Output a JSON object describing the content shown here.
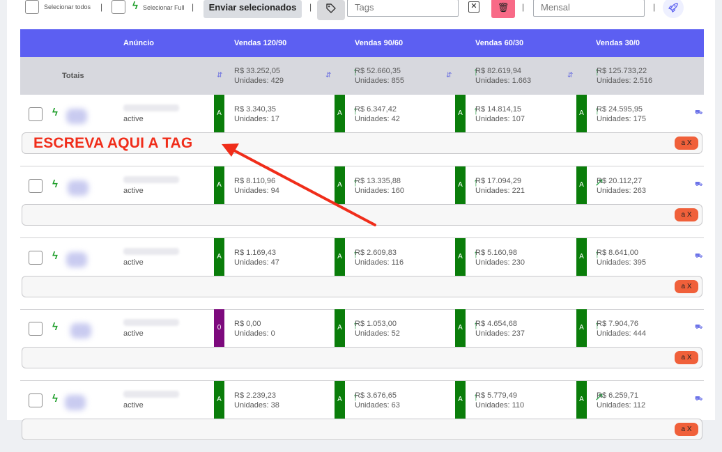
{
  "toolbar": {
    "select_all_label": "Selecionar todos",
    "select_full_label": "Selecionar Full",
    "send_selected_label": "Enviar selecionados",
    "tags_placeholder": "Tags",
    "period_value": "Mensal",
    "clear_label": "✕",
    "trash_label": "🗑",
    "separator": "|"
  },
  "table": {
    "headers": [
      "Anúncio",
      "Vendas 120/90",
      "Vendas 90/60",
      "Vendas 60/30",
      "Vendas 30/0"
    ],
    "totals_label": "Totais",
    "totals": [
      {
        "value": "R$ 33.252,05",
        "units": "Unidades: 429",
        "trend": "flat"
      },
      {
        "value": "R$ 52.660,35",
        "units": "Unidades: 855",
        "trend": "up"
      },
      {
        "value": "R$ 82.619,94",
        "units": "Unidades: 1.663",
        "trend": "up"
      },
      {
        "value": "R$ 125.733,22",
        "units": "Unidades: 2.516",
        "trend": "up"
      }
    ],
    "rows": [
      {
        "status": "active",
        "cells": [
          {
            "grade": "A",
            "value": "R$ 3.340,35",
            "units": "Unidades: 17",
            "trend": "none"
          },
          {
            "grade": "A",
            "value": "R$ 6.347,42",
            "units": "Unidades: 42",
            "trend": "up"
          },
          {
            "grade": "A",
            "value": "R$ 14.814,15",
            "units": "Unidades: 107",
            "trend": "up"
          },
          {
            "grade": "A",
            "value": "R$ 24.595,95",
            "units": "Unidades: 175",
            "trend": "up"
          }
        ]
      },
      {
        "status": "active",
        "cells": [
          {
            "grade": "A",
            "value": "R$ 8.110,96",
            "units": "Unidades: 94",
            "trend": "none"
          },
          {
            "grade": "A",
            "value": "R$ 13.335,88",
            "units": "Unidades: 160",
            "trend": "up"
          },
          {
            "grade": "A",
            "value": "R$ 17.094,29",
            "units": "Unidades: 221",
            "trend": "up"
          },
          {
            "grade": "A",
            "value": "R$ 20.112,27",
            "units": "Unidades: 263",
            "trend": "diag"
          }
        ]
      },
      {
        "status": "active",
        "cells": [
          {
            "grade": "A",
            "value": "R$ 1.169,43",
            "units": "Unidades: 47",
            "trend": "none"
          },
          {
            "grade": "A",
            "value": "R$ 2.609,83",
            "units": "Unidades: 116",
            "trend": "up"
          },
          {
            "grade": "A",
            "value": "R$ 5.160,98",
            "units": "Unidades: 230",
            "trend": "up"
          },
          {
            "grade": "A",
            "value": "R$ 8.641,00",
            "units": "Unidades: 395",
            "trend": "up"
          }
        ]
      },
      {
        "status": "active",
        "cells": [
          {
            "grade": "0",
            "value": "R$ 0,00",
            "units": "Unidades: 0",
            "trend": "none"
          },
          {
            "grade": "A",
            "value": "R$ 1.053,00",
            "units": "Unidades: 52",
            "trend": "up"
          },
          {
            "grade": "A",
            "value": "R$ 4.654,68",
            "units": "Unidades: 237",
            "trend": "up"
          },
          {
            "grade": "A",
            "value": "R$ 7.904,76",
            "units": "Unidades: 444",
            "trend": "up"
          }
        ]
      },
      {
        "status": "active",
        "cells": [
          {
            "grade": "A",
            "value": "R$ 2.239,23",
            "units": "Unidades: 38",
            "trend": "none"
          },
          {
            "grade": "A",
            "value": "R$ 3.676,65",
            "units": "Unidades: 63",
            "trend": "up"
          },
          {
            "grade": "A",
            "value": "R$ 5.779,49",
            "units": "Unidades: 110",
            "trend": "up"
          },
          {
            "grade": "A",
            "value": "R$ 6.259,71",
            "units": "Unidades: 112",
            "trend": "diag"
          }
        ]
      }
    ],
    "tag_pill_label": "a X"
  },
  "annotation": {
    "text": "ESCREVA AQUI A TAG"
  },
  "colors": {
    "header": "#5c5ff2",
    "totals_bg": "#d7d8de",
    "grade_a": "#0a7d0a",
    "grade_zero": "#7d0a7d",
    "trend_up": "#27a045",
    "trash": "#f86a87",
    "pill": "#f0603a",
    "annotation": "#f02d1a"
  }
}
